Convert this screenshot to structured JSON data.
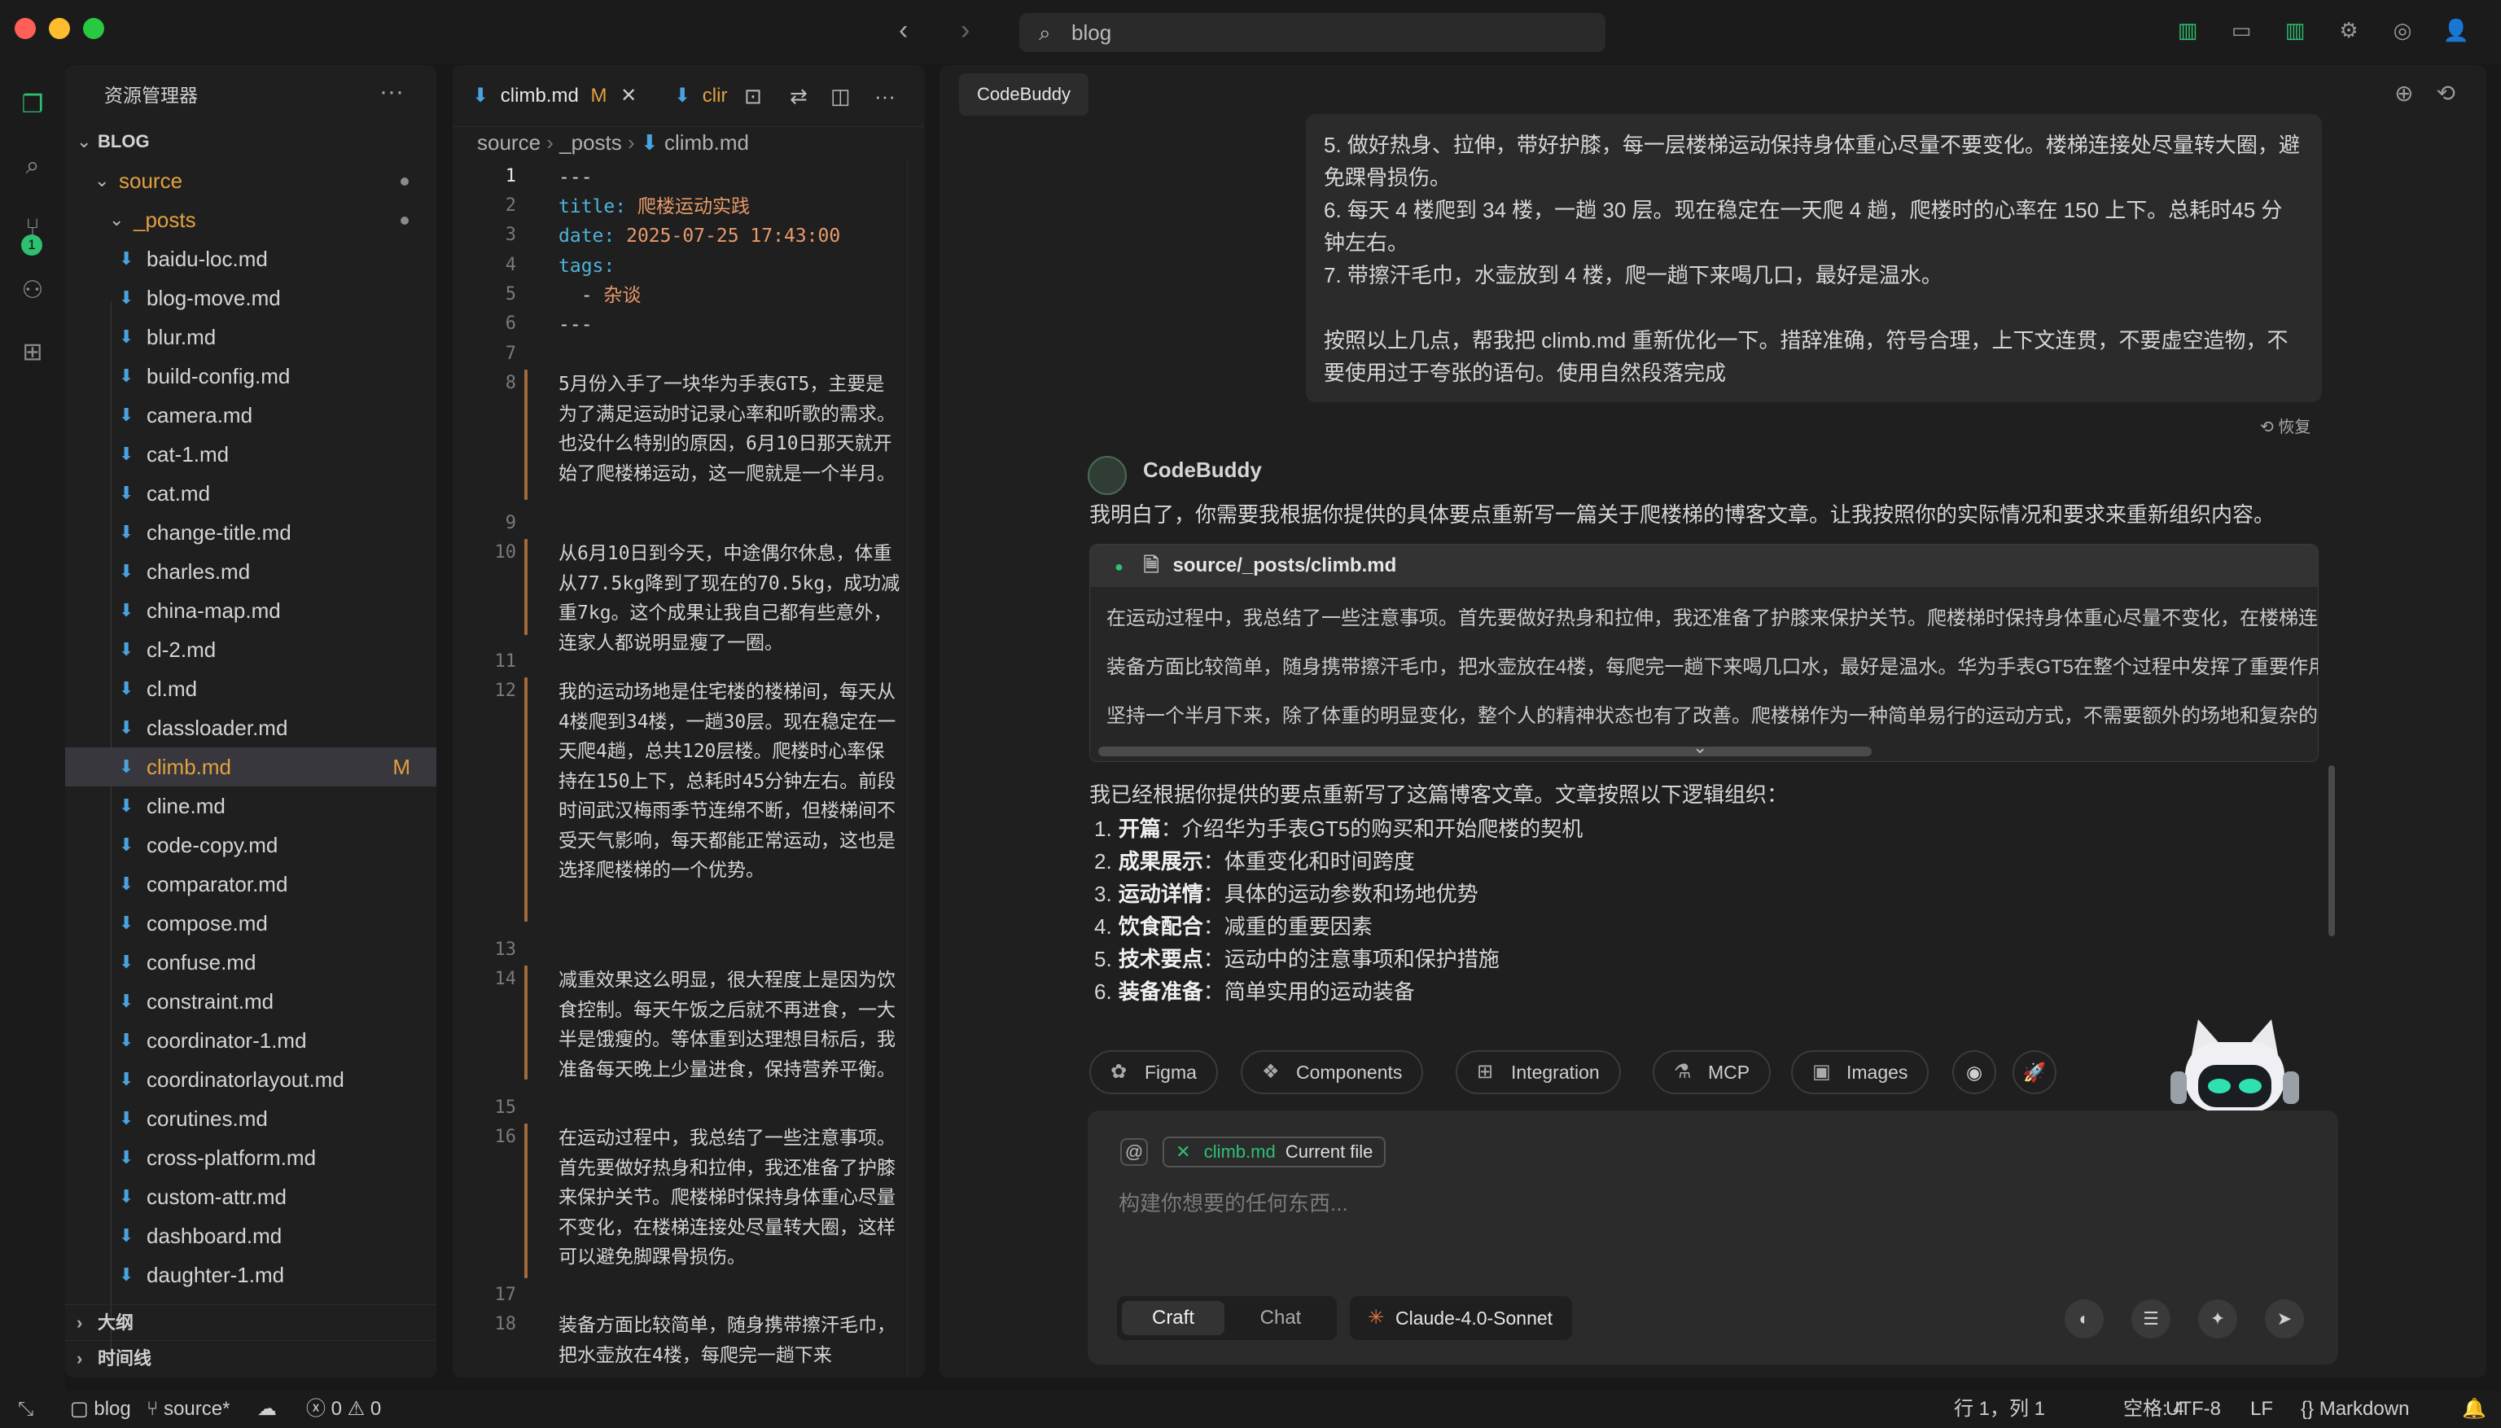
{
  "titlebar": {
    "search_text": "blog"
  },
  "activity": {
    "scm_badge": "1"
  },
  "explorer": {
    "title": "资源管理器",
    "root": "BLOG",
    "folder_source": "source",
    "folder_posts": "_posts",
    "files": [
      "baidu-loc.md",
      "blog-move.md",
      "blur.md",
      "build-config.md",
      "camera.md",
      "cat-1.md",
      "cat.md",
      "change-title.md",
      "charles.md",
      "china-map.md",
      "cl-2.md",
      "cl.md",
      "classloader.md",
      "climb.md",
      "cline.md",
      "code-copy.md",
      "comparator.md",
      "compose.md",
      "confuse.md",
      "constraint.md",
      "coordinator-1.md",
      "coordinatorlayout.md",
      "corutines.md",
      "cross-platform.md",
      "custom-attr.md",
      "dashboard.md",
      "daughter-1.md"
    ],
    "active_file_status": "M",
    "outline": "大纲",
    "timeline": "时间线"
  },
  "editor": {
    "tab1_label": "climb.md",
    "tab1_status": "M",
    "tab2_label": "clir",
    "breadcrumb": {
      "a": "source",
      "b": "_posts",
      "c": "climb.md"
    },
    "lines": [
      {
        "n": "1",
        "t": "---"
      },
      {
        "n": "2",
        "k": "title:",
        "v": " 爬楼运动实践"
      },
      {
        "n": "3",
        "k": "date:",
        "v": " 2025-07-25 17:43:00"
      },
      {
        "n": "4",
        "k": "tags:",
        "v": ""
      },
      {
        "n": "5",
        "t": "  - ",
        "v2": "杂谈"
      },
      {
        "n": "6",
        "t": "---"
      },
      {
        "n": "7",
        "t": ""
      },
      {
        "n": "8",
        "t": "5月份入手了一块华为手表GT5，主要是为了满足运动时记录心率和听歌的需求。也没什么特别的原因，6月10日那天就开始了爬楼梯运动，这一爬就是一个半月。"
      },
      {
        "n": "9",
        "t": ""
      },
      {
        "n": "10",
        "t": "从6月10日到今天，中途偶尔休息，体重从77.5kg降到了现在的70.5kg，成功减重7kg。这个成果让我自己都有些意外，连家人都说明显瘦了一圈。"
      },
      {
        "n": "11",
        "t": ""
      },
      {
        "n": "12",
        "t": "我的运动场地是住宅楼的楼梯间，每天从4楼爬到34楼，一趟30层。现在稳定在一天爬4趟，总共120层楼。爬楼时心率保持在150上下，总耗时45分钟左右。前段时间武汉梅雨季节连绵不断，但楼梯间不受天气影响，每天都能正常运动，这也是选择爬楼梯的一个优势。"
      },
      {
        "n": "13",
        "t": ""
      },
      {
        "n": "14",
        "t": "减重效果这么明显，很大程度上是因为饮食控制。每天午饭之后就不再进食，一大半是饿瘦的。等体重到达理想目标后，我准备每天晚上少量进食，保持营养平衡。"
      },
      {
        "n": "15",
        "t": ""
      },
      {
        "n": "16",
        "t": "在运动过程中，我总结了一些注意事项。首先要做好热身和拉伸，我还准备了护膝来保护关节。爬楼梯时保持身体重心尽量不变化，在楼梯连接处尽量转大圈，这样可以避免脚踝骨损伤。"
      },
      {
        "n": "17",
        "t": ""
      },
      {
        "n": "18",
        "t": "装备方面比较简单，随身携带擦汗毛巾，把水壶放在4楼，每爬完一趟下来"
      }
    ]
  },
  "chat": {
    "tab": "CodeBuddy",
    "user_msg": [
      "5. 做好热身、拉伸，带好护膝，每一层楼梯运动保持身体重心尽量不要变化。楼梯连接处尽量转大圈，避",
      "免踝骨损伤。",
      "6. 每天 4 楼爬到 34 楼，一趟 30 层。现在稳定在一天爬 4 趟，爬楼时的心率在 150 上下。总耗时45 分",
      "钟左右。",
      "7. 带擦汗毛巾，水壶放到 4 楼，爬一趟下来喝几口，最好是温水。",
      "",
      "按照以上几点，帮我把 climb.md 重新优化一下。措辞准确，符号合理，上下文连贯，不要虚空造物，不",
      "要使用过于夸张的语句。使用自然段落完成"
    ],
    "restore": "恢复",
    "bot_name": "CodeBuddy",
    "reply_intro": "我明白了，你需要我根据你提供的具体要点重新写一篇关于爬楼梯的博客文章。让我按照你的实际情况和要求来重新组织内容。",
    "file_card": {
      "path": "source/_posts/climb.md",
      "lines": [
        "在运动过程中，我总结了一些注意事项。首先要做好热身和拉伸，我还准备了护膝来保护关节。爬楼梯时保持身体重心尽量不变化，在楼梯连",
        "装备方面比较简单，随身携带擦汗毛巾，把水壶放在4楼，每爬完一趟下来喝几口水，最好是温水。华为手表GT5在整个过程中发挥了重要作用",
        "坚持一个半月下来，除了体重的明显变化，整个人的精神状态也有了改善。爬楼梯作为一种简单易行的运动方式，不需要额外的场地和复杂的"
      ]
    },
    "summary": "我已经根据你提供的要点重新写了这篇博客文章。文章按照以下逻辑组织：",
    "list": [
      {
        "n": "1.",
        "b": "开篇",
        "t": "：介绍华为手表GT5的购买和开始爬楼的契机"
      },
      {
        "n": "2.",
        "b": "成果展示",
        "t": "：体重变化和时间跨度"
      },
      {
        "n": "3.",
        "b": "运动详情",
        "t": "：具体的运动参数和场地优势"
      },
      {
        "n": "4.",
        "b": "饮食配合",
        "t": "：减重的重要因素"
      },
      {
        "n": "5.",
        "b": "技术要点",
        "t": "：运动中的注意事项和保护措施"
      },
      {
        "n": "6.",
        "b": "装备准备",
        "t": "：简单实用的运动装备"
      }
    ],
    "chips": [
      "Figma",
      "Components",
      "Integration",
      "MCP",
      "Images"
    ],
    "input": {
      "ctx_file": "climb.md",
      "ctx_label": "Current file",
      "placeholder": "构建你想要的任何东西...",
      "mode_craft": "Craft",
      "mode_chat": "Chat",
      "model": "Claude-4.0-Sonnet"
    }
  },
  "status": {
    "folder": "blog",
    "branch": "source*",
    "errors": "0",
    "warnings": "0",
    "position": "行 1，列 1",
    "spaces": "空格: 4",
    "encoding": "UTF-8",
    "eol": "LF",
    "language": "Markdown"
  },
  "colors": {
    "accent": "#2fbf71",
    "modified": "#e2a13f",
    "key": "#4fb3d9",
    "value": "#e89a6a"
  }
}
